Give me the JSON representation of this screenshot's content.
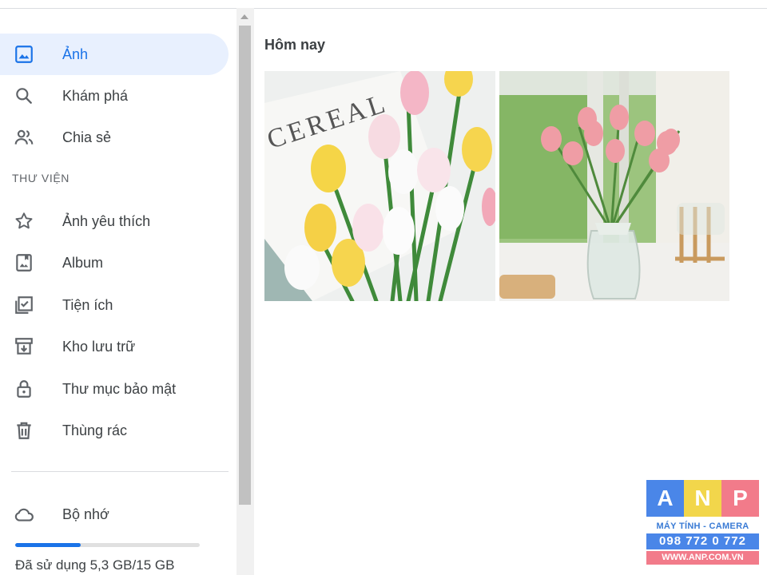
{
  "sidebar": {
    "items": [
      {
        "label": "Ảnh",
        "icon": "photo-icon",
        "active": true
      },
      {
        "label": "Khám phá",
        "icon": "search-icon",
        "active": false
      },
      {
        "label": "Chia sẻ",
        "icon": "people-icon",
        "active": false
      }
    ],
    "library_heading": "THƯ VIỆN",
    "library_items": [
      {
        "label": "Ảnh yêu thích",
        "icon": "star-icon"
      },
      {
        "label": "Album",
        "icon": "album-icon"
      },
      {
        "label": "Tiện ích",
        "icon": "utilities-icon"
      },
      {
        "label": "Kho lưu trữ",
        "icon": "archive-icon"
      },
      {
        "label": "Thư mục bảo mật",
        "icon": "lock-icon"
      },
      {
        "label": "Thùng rác",
        "icon": "trash-icon"
      }
    ],
    "storage": {
      "label": "Bộ nhớ",
      "icon": "cloud-icon",
      "used_text": "Đã sử dụng 5,3 GB/15 GB",
      "used_fraction": 0.353
    }
  },
  "main": {
    "section_title": "Hôm nay",
    "photos": [
      {
        "name": "tulips-flatlay-photo",
        "print_text": "CEREAL"
      },
      {
        "name": "tulips-vase-photo"
      }
    ]
  },
  "watermark": {
    "letters": [
      "A",
      "N",
      "P"
    ],
    "tagline": "MÁY TÍNH - CAMERA",
    "phone": "098 772 0 772",
    "website": "WWW.ANP.COM.VN"
  },
  "colors": {
    "accent": "#1a73e8",
    "active_bg": "#e8f0fe",
    "text": "#3c4043",
    "logo_a": "#4a86e8",
    "logo_n": "#f2d64b",
    "logo_p": "#f27b8a"
  }
}
